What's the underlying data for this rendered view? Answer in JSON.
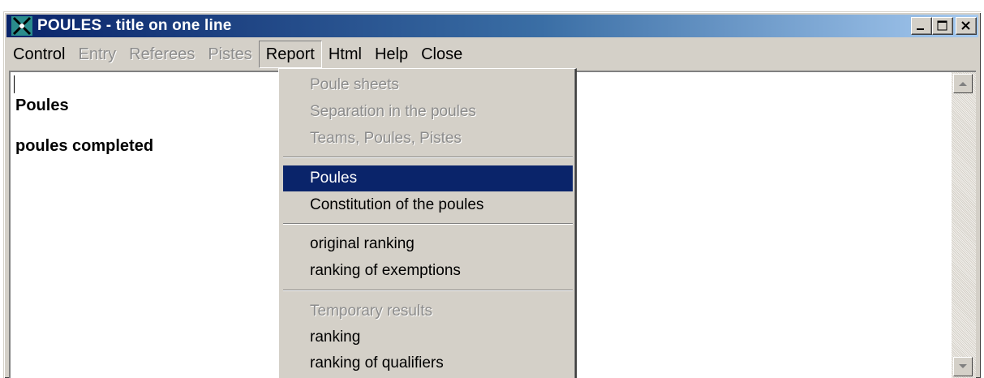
{
  "window": {
    "title": "POULES - title on one line",
    "app_icon": "fencing-icon",
    "controls": [
      "minimize",
      "maximize",
      "close"
    ]
  },
  "menubar": {
    "items": [
      {
        "label": "Control",
        "enabled": true
      },
      {
        "label": "Entry",
        "enabled": false
      },
      {
        "label": "Referees",
        "enabled": false
      },
      {
        "label": "Pistes",
        "enabled": false
      },
      {
        "label": "Report",
        "enabled": true,
        "open": true
      },
      {
        "label": "Html",
        "enabled": true
      },
      {
        "label": "Help",
        "enabled": true
      },
      {
        "label": "Close",
        "enabled": true
      }
    ]
  },
  "content": {
    "lines": [
      "Poules",
      "poules completed"
    ]
  },
  "report_menu": {
    "groups": [
      [
        {
          "label": "Poule sheets",
          "enabled": false
        },
        {
          "label": "Separation in the poules",
          "enabled": false
        },
        {
          "label": "Teams, Poules, Pistes",
          "enabled": false
        }
      ],
      [
        {
          "label": "Poules",
          "enabled": true,
          "selected": true
        },
        {
          "label": "Constitution of the poules",
          "enabled": true
        }
      ],
      [
        {
          "label": "original ranking",
          "enabled": true
        },
        {
          "label": "ranking of exemptions",
          "enabled": true
        }
      ],
      [
        {
          "label": "Temporary results",
          "enabled": false
        },
        {
          "label": "ranking",
          "enabled": true
        },
        {
          "label": "ranking of qualifiers",
          "enabled": true
        }
      ]
    ]
  },
  "colors": {
    "titlebar_start": "#0a246a",
    "titlebar_end": "#a6caf0",
    "menu_face": "#d4d0c8",
    "highlight": "#0a246a",
    "disabled_text": "#8c8c8c"
  }
}
